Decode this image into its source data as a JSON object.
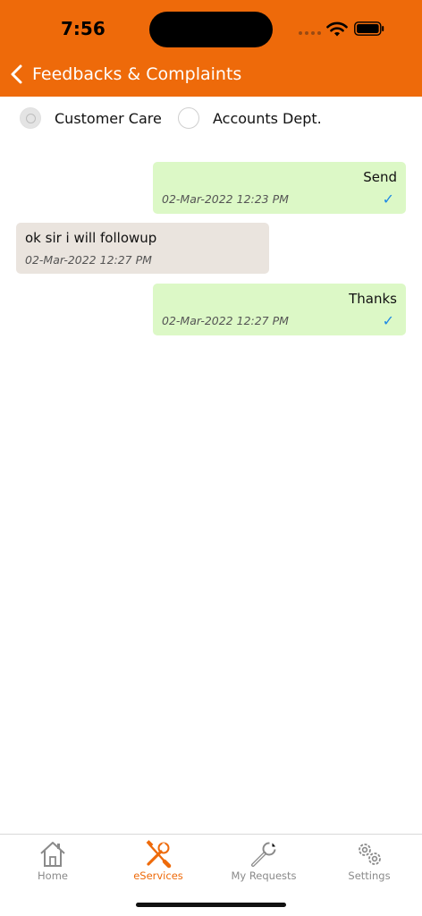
{
  "status": {
    "time": "7:56"
  },
  "header": {
    "title": "Feedbacks & Complaints"
  },
  "departments": [
    {
      "label": "Customer Care",
      "selected": true
    },
    {
      "label": "Accounts Dept.",
      "selected": false
    }
  ],
  "messages": [
    {
      "direction": "out",
      "text": "Send",
      "timestamp": "02-Mar-2022 12:23 PM",
      "read_mark": "✓"
    },
    {
      "direction": "in",
      "text": "ok sir i will followup",
      "timestamp": "02-Mar-2022 12:27 PM"
    },
    {
      "direction": "out",
      "text": "Thanks",
      "timestamp": "02-Mar-2022 12:27 PM",
      "read_mark": "✓"
    }
  ],
  "tabs": [
    {
      "label": "Home",
      "icon": "home-icon",
      "active": false
    },
    {
      "label": "eServices",
      "icon": "tools-icon",
      "active": true
    },
    {
      "label": "My Requests",
      "icon": "wrench-icon",
      "active": false
    },
    {
      "label": "Settings",
      "icon": "gears-icon",
      "active": false
    }
  ],
  "colors": {
    "brand": "#EE6A0A",
    "outgoing_bubble": "#DCF8C6",
    "incoming_bubble": "#EAE4DE",
    "check": "#1E88E5"
  }
}
